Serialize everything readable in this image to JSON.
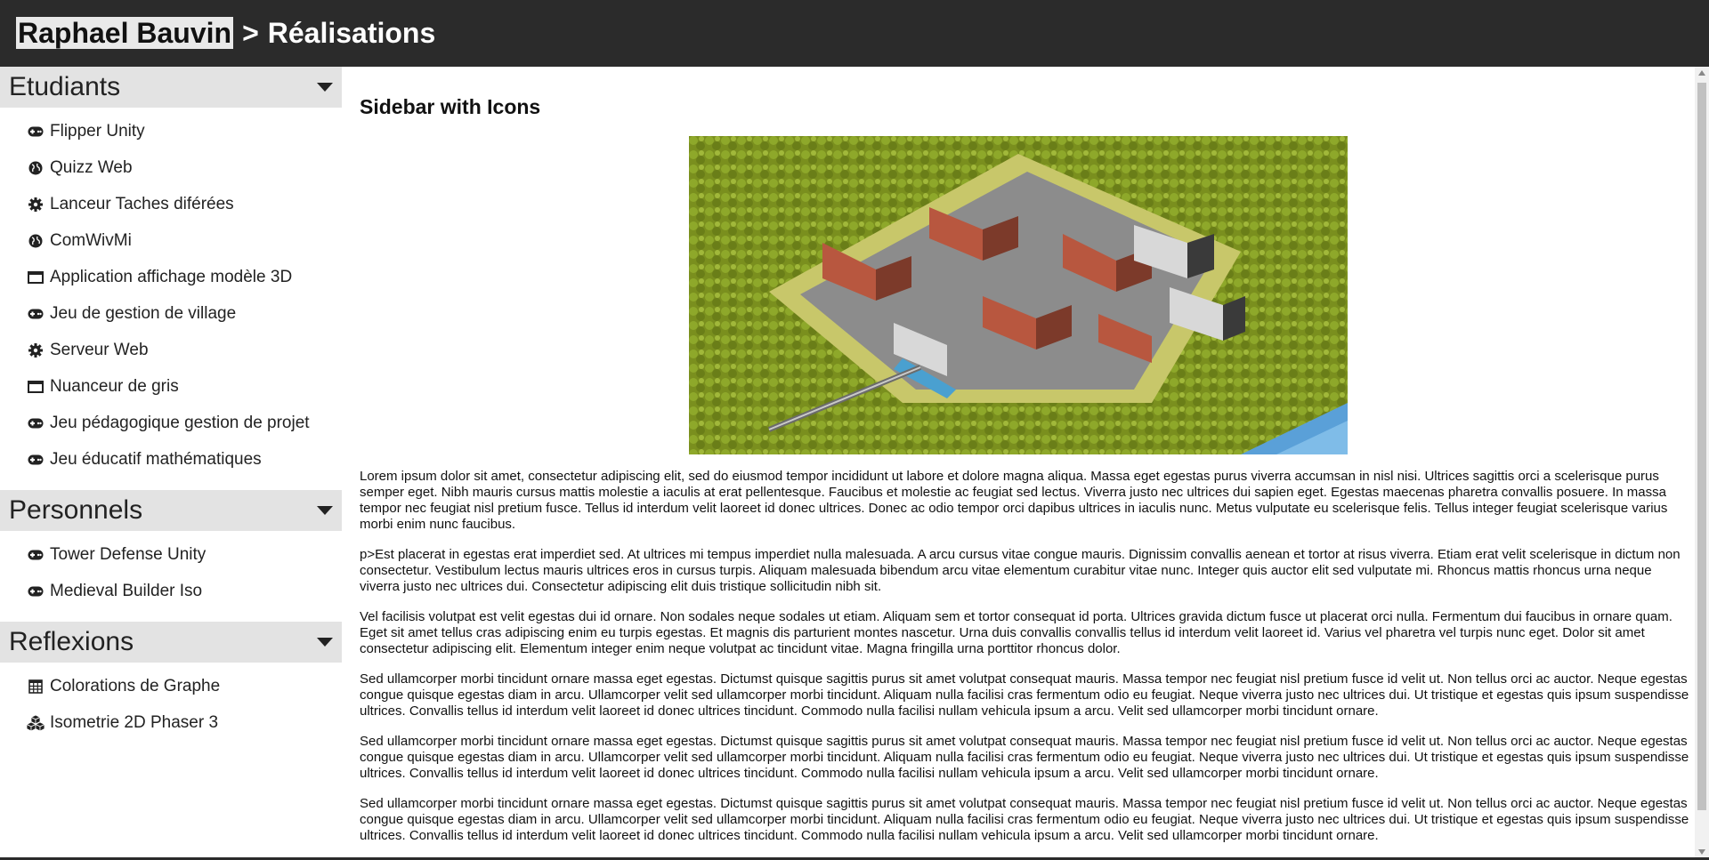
{
  "header": {
    "brand": "Raphael Bauvin",
    "separator": ">",
    "page": "Réalisations"
  },
  "sidebar": {
    "sections": [
      {
        "title": "Etudiants",
        "items": [
          {
            "label": "Flipper Unity",
            "icon": "gamepad-icon"
          },
          {
            "label": "Quizz Web",
            "icon": "globe-icon"
          },
          {
            "label": "Lanceur Taches diférées",
            "icon": "gear-icon"
          },
          {
            "label": "ComWivMi",
            "icon": "globe-icon"
          },
          {
            "label": "Application affichage modèle 3D",
            "icon": "window-icon"
          },
          {
            "label": "Jeu de gestion de village",
            "icon": "gamepad-icon"
          },
          {
            "label": "Serveur Web",
            "icon": "gear-icon"
          },
          {
            "label": "Nuanceur de gris",
            "icon": "window-icon"
          },
          {
            "label": "Jeu pédagogique gestion de projet",
            "icon": "gamepad-icon"
          },
          {
            "label": "Jeu éducatif mathématiques",
            "icon": "gamepad-icon"
          }
        ]
      },
      {
        "title": "Personnels",
        "items": [
          {
            "label": "Tower Defense Unity",
            "icon": "gamepad-icon"
          },
          {
            "label": "Medieval Builder Iso",
            "icon": "gamepad-icon"
          }
        ]
      },
      {
        "title": "Reflexions",
        "items": [
          {
            "label": "Colorations de Graphe",
            "icon": "table-icon"
          },
          {
            "label": "Isometrie 2D Phaser 3",
            "icon": "cubes-icon"
          }
        ]
      }
    ]
  },
  "main": {
    "heading": "Sidebar with Icons",
    "paragraphs": [
      "Lorem ipsum dolor sit amet, consectetur adipiscing elit, sed do eiusmod tempor incididunt ut labore et dolore magna aliqua. Massa eget egestas purus viverra accumsan in nisl nisi. Ultrices sagittis orci a scelerisque purus semper eget. Nibh mauris cursus mattis molestie a iaculis at erat pellentesque. Faucibus et molestie ac feugiat sed lectus. Viverra justo nec ultrices dui sapien eget. Egestas maecenas pharetra convallis posuere. In massa tempor nec feugiat nisl pretium fusce. Tellus id interdum velit laoreet id donec ultrices. Donec ac odio tempor orci dapibus ultrices in iaculis nunc. Metus vulputate eu scelerisque felis. Tellus integer feugiat scelerisque varius morbi enim nunc faucibus.",
      "p>Est placerat in egestas erat imperdiet sed. At ultrices mi tempus imperdiet nulla malesuada. A arcu cursus vitae congue mauris. Dignissim convallis aenean et tortor at risus viverra. Etiam erat velit scelerisque in dictum non consectetur. Vestibulum lectus mauris ultrices eros in cursus turpis. Aliquam malesuada bibendum arcu vitae elementum curabitur vitae nunc. Integer quis auctor elit sed vulputate mi. Rhoncus mattis rhoncus urna neque viverra justo nec ultrices dui. Consectetur adipiscing elit duis tristique sollicitudin nibh sit.",
      "Vel facilisis volutpat est velit egestas dui id ornare. Non sodales neque sodales ut etiam. Aliquam sem et tortor consequat id porta. Ultrices gravida dictum fusce ut placerat orci nulla. Fermentum dui faucibus in ornare quam. Eget sit amet tellus cras adipiscing enim eu turpis egestas. Et magnis dis parturient montes nascetur. Urna duis convallis convallis tellus id interdum velit laoreet id. Varius vel pharetra vel turpis nunc eget. Dolor sit amet consectetur adipiscing elit. Elementum integer enim neque volutpat ac tincidunt vitae. Magna fringilla urna porttitor rhoncus dolor.",
      "Sed ullamcorper morbi tincidunt ornare massa eget egestas. Dictumst quisque sagittis purus sit amet volutpat consequat mauris. Massa tempor nec feugiat nisl pretium fusce id velit ut. Non tellus orci ac auctor. Neque egestas congue quisque egestas diam in arcu. Ullamcorper velit sed ullamcorper morbi tincidunt. Aliquam nulla facilisi cras fermentum odio eu feugiat. Neque viverra justo nec ultrices dui. Ut tristique et egestas quis ipsum suspendisse ultrices. Convallis tellus id interdum velit laoreet id donec ultrices tincidunt. Commodo nulla facilisi nullam vehicula ipsum a arcu. Velit sed ullamcorper morbi tincidunt ornare.",
      "Sed ullamcorper morbi tincidunt ornare massa eget egestas. Dictumst quisque sagittis purus sit amet volutpat consequat mauris. Massa tempor nec feugiat nisl pretium fusce id velit ut. Non tellus orci ac auctor. Neque egestas congue quisque egestas diam in arcu. Ullamcorper velit sed ullamcorper morbi tincidunt. Aliquam nulla facilisi cras fermentum odio eu feugiat. Neque viverra justo nec ultrices dui. Ut tristique et egestas quis ipsum suspendisse ultrices. Convallis tellus id interdum velit laoreet id donec ultrices tincidunt. Commodo nulla facilisi nullam vehicula ipsum a arcu. Velit sed ullamcorper morbi tincidunt ornare.",
      "Sed ullamcorper morbi tincidunt ornare massa eget egestas. Dictumst quisque sagittis purus sit amet volutpat consequat mauris. Massa tempor nec feugiat nisl pretium fusce id velit ut. Non tellus orci ac auctor. Neque egestas congue quisque egestas diam in arcu. Ullamcorper velit sed ullamcorper morbi tincidunt. Aliquam nulla facilisi cras fermentum odio eu feugiat. Neque viverra justo nec ultrices dui. Ut tristique et egestas quis ipsum suspendisse ultrices. Convallis tellus id interdum velit laoreet id donec ultrices tincidunt. Commodo nulla facilisi nullam vehicula ipsum a arcu. Velit sed ullamcorper morbi tincidunt ornare."
    ]
  },
  "colors": {
    "header_bg": "#2b2b2b",
    "section_bg": "#e3e3e3",
    "text": "#222222"
  }
}
